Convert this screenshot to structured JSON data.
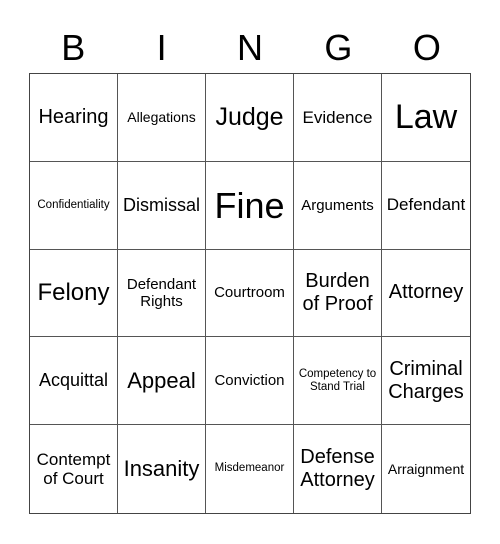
{
  "header": [
    "B",
    "I",
    "N",
    "G",
    "O"
  ],
  "cells": [
    [
      "Hearing",
      "Allegations",
      "Judge",
      "Evidence",
      "Law"
    ],
    [
      "Confidentiality",
      "Dismissal",
      "Fine",
      "Arguments",
      "Defendant"
    ],
    [
      "Felony",
      "Defendant Rights",
      "Courtroom",
      "Burden of Proof",
      "Attorney"
    ],
    [
      "Acquittal",
      "Appeal",
      "Conviction",
      "Competency to Stand Trial",
      "Criminal Charges"
    ],
    [
      "Contempt of Court",
      "Insanity",
      "Misdemeanor",
      "Defense Attorney",
      "Arraignment"
    ]
  ]
}
